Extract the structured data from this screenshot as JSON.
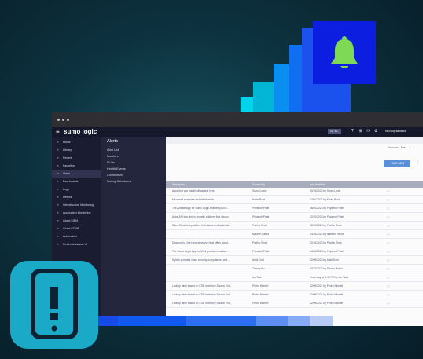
{
  "colors": {
    "accent_blue": "#2e5bef",
    "bell_bg": "#0c1fe0",
    "bell_green": "#7ed957",
    "phone_tile": "#1aa9c6",
    "add_button": "#5b8fd8"
  },
  "app": {
    "logo": "sumo logic",
    "topbar_button": "Go To...",
    "user_name": "van.ving.sandbox"
  },
  "sidebar": {
    "items": [
      {
        "label": "Home",
        "icon": "home-icon"
      },
      {
        "label": "Library",
        "icon": "folder-icon"
      },
      {
        "label": "Recent",
        "icon": "clock-icon"
      },
      {
        "label": "Favorites",
        "icon": "star-icon"
      },
      {
        "label": "Alerts",
        "icon": "bell-icon"
      },
      {
        "label": "Dashboards",
        "icon": "dashboard-icon"
      },
      {
        "label": "Logs",
        "icon": "logs-icon"
      },
      {
        "label": "Metrics",
        "icon": "metrics-icon"
      },
      {
        "label": "Infrastructure Monitoring",
        "icon": "infra-icon"
      },
      {
        "label": "Application Monitoring",
        "icon": "app-monitor-icon"
      },
      {
        "label": "Cloud SIEM",
        "icon": "siem-icon"
      },
      {
        "label": "Cloud SOAR",
        "icon": "soar-icon"
      },
      {
        "label": "Automation",
        "icon": "automation-icon"
      },
      {
        "label": "Return to classic UI",
        "icon": "return-icon"
      }
    ]
  },
  "alerts_nav": {
    "title": "Alerts",
    "items": [
      "Alert List",
      "Monitors",
      "SLOs",
      "Health Events",
      "Connections",
      "Muting Schedules"
    ]
  },
  "main": {
    "views_label": "Views as:",
    "views_value": "Me",
    "add_new": "+ ADD NEW",
    "columns": [
      "Description",
      "Created By",
      "Last Modified"
    ],
    "rows": [
      [
        "Apps that you install will appear here",
        "Sumo Logic",
        "10/19/2023 by Sumo Logic"
      ],
      [
        "My saved searches and dashboards",
        "Kevin Bunt",
        "03/01/2022 by Kevin Bunt"
      ],
      [
        "The Ansible App for Sumo Logic enables you to...",
        "Priyansh Patel",
        "08/01/2023 by Priyansh Patel"
      ],
      [
        "Astra API is a driven security platform that discov...",
        "Priyansh Patel",
        "02/22/2023 by Priyansh Patel"
      ],
      [
        "Claro Cloud is a platform that tracks and administ...",
        "Parthiv Shah",
        "02/20/2023 by Parthiv Shah"
      ],
      [
        "",
        "Naveen Ratna",
        "03/16/2023 by Naveen Ratna"
      ],
      [
        "Dropbox is a file hosting service that offers cloud...",
        "Parthiv Shah",
        "02/16/2023 by Parthiv Shah"
      ],
      [
        "The Sumo Logic App for Mimi provides installat...",
        "Priyansh Patel",
        "04/06/2023 by Priyansh Patel"
      ],
      [
        "Spidys provides cloud security, compliance, and...",
        "Ankit Goel",
        "12/09/2023 by Ankit Goel"
      ],
      [
        "",
        "Chung Wu",
        "03/27/2023 by Steven Rubin"
      ],
      [
        "",
        "Ian Tsai",
        "Yesterday at 2:40 PM by Ian Tsai"
      ],
      [
        "Lookup table based on CSE Inventory Source Ent...",
        "Pedro Montiel",
        "12/09/2021 by Pedro Montiel"
      ],
      [
        "Lookup table based on CSE Inventory Source Ent...",
        "Pedro Montiel",
        "12/09/2021 by Pedro Montiel"
      ],
      [
        "Lookup table based on CSE Inventory Source Ent...",
        "Pedro Montiel",
        "12/09/2021 by Pedro Montiel"
      ]
    ]
  }
}
